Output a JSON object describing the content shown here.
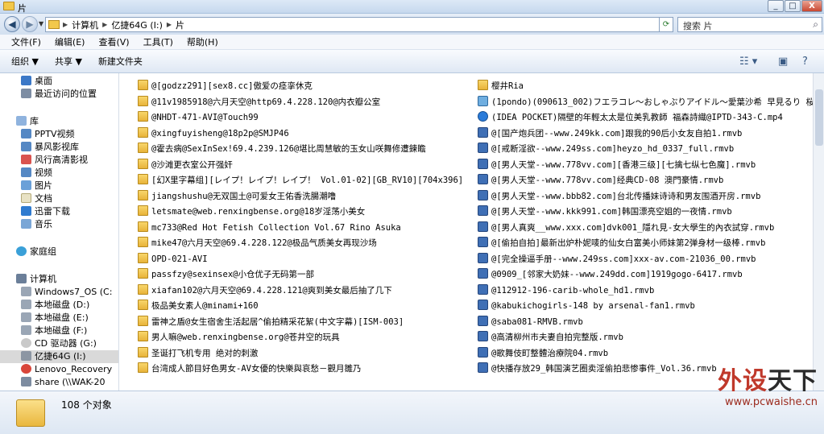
{
  "window": {
    "title": "片"
  },
  "window_buttons": {
    "minimize": "_",
    "restore": "□",
    "close": "X"
  },
  "address": {
    "breadcrumbs": [
      "计算机",
      "亿捷64G (I:)",
      "片"
    ],
    "search_placeholder": "搜索 片"
  },
  "menu": [
    "文件(F)",
    "编辑(E)",
    "查看(V)",
    "工具(T)",
    "帮助(H)"
  ],
  "toolbar": {
    "organize": "组织 ▼",
    "share": "共享 ▼",
    "new_folder": "新建文件夹"
  },
  "sidebar": {
    "favorites": [
      "桌面",
      "最近访问的位置"
    ],
    "libraries_header": "库",
    "libraries": [
      "PPTV视频",
      "暴风影视库",
      "风行高清影视",
      "视频",
      "图片",
      "文档",
      "迅雷下载",
      "音乐"
    ],
    "homegroup": "家庭组",
    "computer_header": "计算机",
    "drives": [
      "Windows7_OS (C:",
      "本地磁盘 (D:)",
      "本地磁盘 (E:)",
      "本地磁盘 (F:)",
      "CD 驱动器 (G:)",
      "亿捷64G (I:)",
      "Lenovo_Recovery",
      "share (\\\\WAK-20"
    ]
  },
  "files_col1": [
    "@[godzz291][sex8.cc]傲爱の痉挛休克",
    "@11v1985918@六月天空@http69.4.228.120@内衣瓣公室",
    "@NHDT-471-AVI@Touch99",
    "@xingfuyisheng@18p2p@SMJP46",
    "@霍去病@SexInSex!69.4.239.126@堪比周慧敏的玉女山咲舞修遭鍊瞻",
    "@沙滩更衣室公开强奸",
    "[幻X里字幕组][レイプ！レイプ！レイプ！ Vol.01-02][GB_RV10][704x396]",
    "jiangshushu@无双国土@可爱女王佑香洗腸潮噜",
    "letsmate@web.renxingbense.org@18岁淫荡小美女",
    "mc733@Red Hot Fetish Collection Vol.67 Rino Asuka",
    "mike47@六月天空@69.4.228.122@极品气质美女再现沙场",
    "OPD-021-AVI",
    "passfzy@sexinsex@小仓优子无码第一部",
    "xiafan102@六月天空@69.4.228.121@爽到美女最后抽了几下",
    "极品美女素人@minami+160",
    "雷神之盾@女生宿舍生活起居^偷拍精采花絮(中文字幕)[ISM-003]",
    "男人嘛@web.renxingbense.org@苍井空的玩具",
    "圣诞打飞机专用  绝对的刺激",
    "台湾成人節目好色男女-AV女優的快樂與哀愁－觀月雛乃"
  ],
  "files_col2": [
    "樱井Ria",
    "(1pondo)(090613_002)フエラコレ～おしゃぶりアイドル～愛葉沙希 早見るり 桜",
    "(IDEA POCKET)隔壁的年輕太太是位美乳教師 福森詩織@IPTD-343-C.mp4",
    "@[国产炮兵团--www.249kk.com]跟我的90后小女友自拍1.rmvb",
    "@[戒断淫欲--www.249ss.com]heyzo_hd_0337_full.rmvb",
    "@[男人天堂--www.778vv.com][香港三级][七擒七纵七色魔].rmvb",
    "@[男人天堂--www.778vv.com]经典CD-08 澳門豪情.rmvb",
    "@[男人天堂--www.bbb82.com]台北传播妹诗诗和男友围酒开房.rmvb",
    "@[男人天堂--www.kkk991.com]韩国漂亮空姐的一夜情.rmvb",
    "@[男人真爽__www.xxx.com]dvk001_隱れ見-女大學生的內衣試穿.rmvb",
    "@[偷拍自拍]最新出炉朴妮唛的仙女白富美小师妹第2弹身材一级棒.rmvb",
    "@[完全操逼手册--www.249ss.com]xxx-av.com-21036_00.rmvb",
    "@0909_[邻家大奶妹--www.249dd.com]1919gogo-6417.rmvb",
    "@112912-196-carib-whole_hd1.rmvb",
    "@kabukichogirls-148 by arsenal-fan1.rmvb",
    "@saba081-RMVB.rmvb",
    "@高清柳州市夫妻自拍完整版.rmvb",
    "@歌舞伎町整體治療院04.rmvb",
    "@快播存放29_韩国演艺圈卖淫偷拍悲惨事件_Vol.36.rmvb"
  ],
  "status": {
    "count_text": "108 个对象"
  },
  "watermark": {
    "text_red": "外设",
    "text_dark": "天下",
    "url": "www.pcwaishe.cn"
  }
}
